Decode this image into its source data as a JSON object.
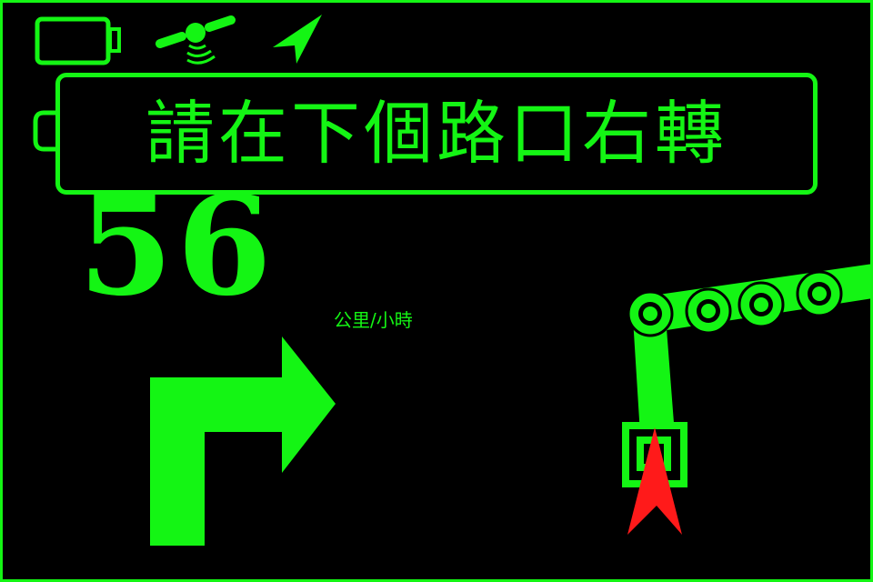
{
  "status_bar": {
    "battery_icon": "battery-empty-icon",
    "satellite_icon": "gps-satellite-icon",
    "location_icon": "location-arrow-icon"
  },
  "instruction": {
    "text": "請在下個路口右轉"
  },
  "speed": {
    "value": "56",
    "unit": "公里/小時"
  },
  "maneuver": {
    "icon": "turn-right-arrow-icon"
  },
  "map": {
    "position_marker_icon": "vehicle-heading-arrow-icon",
    "waypoint_icon": "waypoint-ring-icon"
  },
  "colors": {
    "accent": "#14f514",
    "background": "#000000",
    "marker": "#ff1a1a"
  }
}
